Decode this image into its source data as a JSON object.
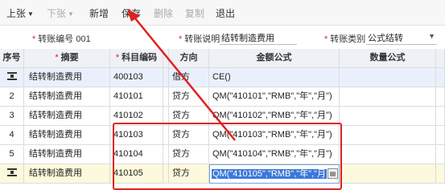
{
  "toolbar": {
    "prev_label": "上张",
    "next_label": "下张",
    "add_label": "新增",
    "save_label": "保存",
    "delete_label": "删除",
    "copy_label": "复制",
    "exit_label": "退出"
  },
  "form": {
    "voucher_no_label": "转账编号",
    "voucher_no_value": "001",
    "desc_label": "转账说明",
    "desc_value": "结转制造费用",
    "type_label": "转账类别",
    "type_value": "公式结转"
  },
  "grid": {
    "headers": {
      "seq": "序号",
      "summary": "摘要",
      "account_code": "科目编码",
      "direction": "方向",
      "amount_formula": "金额公式",
      "qty_formula": "数量公式"
    },
    "rows": [
      {
        "seq": "",
        "summary": "结转制造费用",
        "code": "400103",
        "direction": "借方",
        "formula": "CE()"
      },
      {
        "seq": "2",
        "summary": "结转制造费用",
        "code": "410101",
        "direction": "贷方",
        "formula": "QM(\"410101\",\"RMB\",\"年\",\"月\")"
      },
      {
        "seq": "3",
        "summary": "结转制造费用",
        "code": "410102",
        "direction": "贷方",
        "formula": "QM(\"410102\",\"RMB\",\"年\",\"月\")"
      },
      {
        "seq": "4",
        "summary": "结转制造费用",
        "code": "410103",
        "direction": "贷方",
        "formula": "QM(\"410103\",\"RMB\",\"年\",\"月\")"
      },
      {
        "seq": "5",
        "summary": "结转制造费用",
        "code": "410104",
        "direction": "贷方",
        "formula": "QM(\"410104\",\"RMB\",\"年\",\"月\")"
      },
      {
        "seq": "",
        "summary": "结转制造费用",
        "code": "410105",
        "direction": "贷方",
        "formula": "QM(\"410105\",\"RMB\",\"年\",\"月"
      }
    ]
  },
  "colors": {
    "annotation": "#e02020",
    "selection": "#3b78d8",
    "active_row": "#fdf9dc",
    "selected_row": "#eaf0fb"
  }
}
